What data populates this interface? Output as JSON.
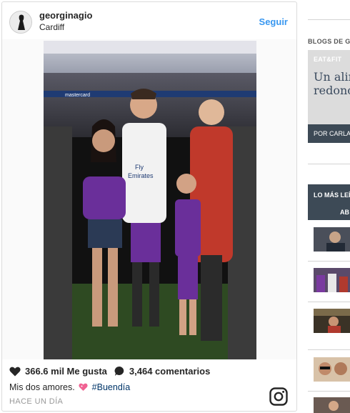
{
  "post": {
    "username": "georginagio",
    "location": "Cardiff",
    "follow_label": "Seguir",
    "likes": "366.6 mil Me gusta",
    "comments": "3,464 comentarios",
    "caption_text": "Mis dos amores.",
    "hashtag": "#Buendía",
    "time_ago": "HACE UN DÍA",
    "photo_texts": {
      "banner": "mastercard",
      "shirt_line1": "Fly",
      "shirt_line2": "Emirates"
    }
  },
  "sidebar": {
    "blogs_title": "BLOGS DE GE",
    "blog_tag": "EAT&FIT",
    "blog_headline_line1": "Un alir",
    "blog_headline_line2": "redonc",
    "blog_author": "POR CARLA",
    "most_read_line1": "LO MÁS LEÍ",
    "most_read_line2": "AB"
  },
  "colors": {
    "follow_blue": "#3897f0",
    "hashtag_blue": "#003569",
    "sidebar_dark": "#3d4a56",
    "headline_slate": "#3a4a5e"
  },
  "icons": [
    "heart-icon",
    "comment-bubble-icon",
    "heart-sticker-icon",
    "instagram-logo-icon"
  ]
}
